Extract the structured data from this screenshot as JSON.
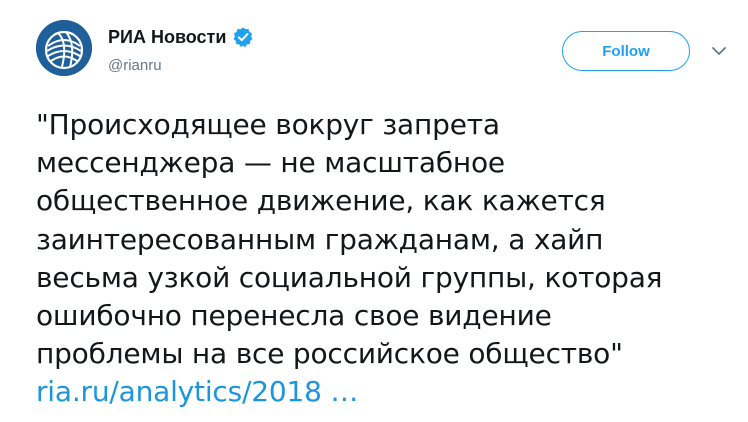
{
  "account": {
    "display_name": "РИА Новости",
    "handle": "@rianru",
    "verified": true
  },
  "actions": {
    "follow_label": "Follow"
  },
  "tweet": {
    "lines": [
      "\"Происходящее вокруг запрета",
      "мессенджера — не масштабное",
      "общественное движение, как кажется",
      "заинтересованным гражданам, а хайп",
      "весьма узкой социальной группы, которая",
      "ошибочно перенесла свое видение",
      "проблемы на все российское общество\""
    ],
    "link_text": "ria.ru/analytics/2018 …"
  },
  "icons": {
    "avatar": "ria-logo-avatar",
    "verified": "verified-badge-icon",
    "caret": "chevron-down-icon"
  },
  "colors": {
    "brand_blue": "#1da1f2",
    "link_blue": "#1b95e0",
    "text": "#14171a",
    "secondary_text": "#657786",
    "avatar_bg": "#1f5f9a"
  }
}
